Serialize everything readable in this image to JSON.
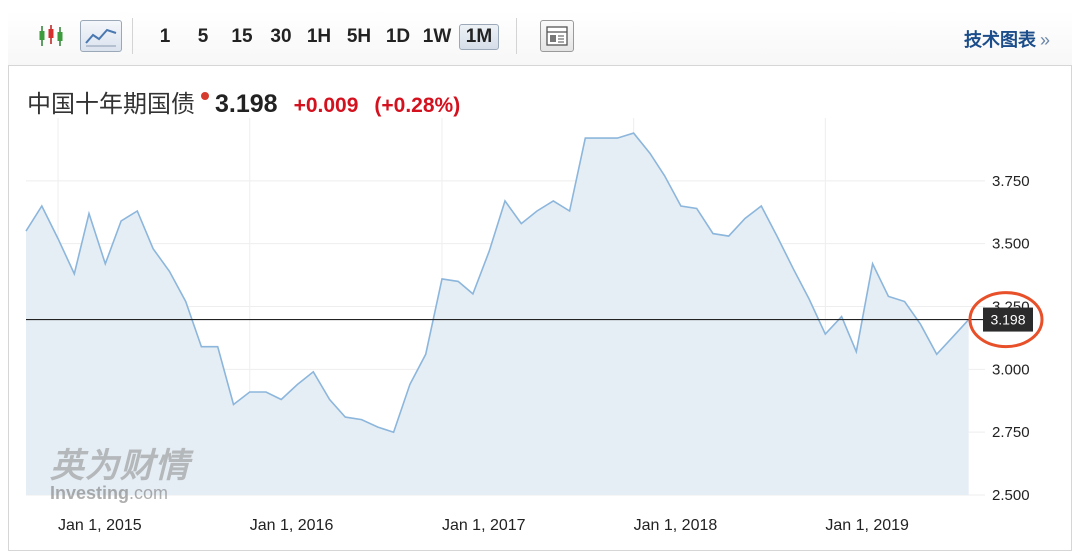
{
  "toolbar": {
    "intervals": [
      "1",
      "5",
      "15",
      "30",
      "1H",
      "5H",
      "1D",
      "1W",
      "1M"
    ],
    "active_interval": "1M",
    "tech_chart_label": "技术图表",
    "tech_chart_chevron": "»"
  },
  "quote": {
    "name": "中国十年期国债",
    "price": "3.198",
    "change": "+0.009",
    "change_pct": "(+0.28%)",
    "change_color": "#d4111e"
  },
  "watermark": {
    "cn": "英为财情",
    "en": "Investing",
    "en_suffix": ".com"
  },
  "chart_data": {
    "type": "area",
    "x_ticks": [
      "Jan 1, 2015",
      "Jan 1, 2016",
      "Jan 1, 2017",
      "Jan 1, 2018",
      "Jan 1, 2019"
    ],
    "y_ticks": [
      "3.750",
      "3.500",
      "3.250",
      "3.000",
      "2.750",
      "2.500"
    ],
    "ylim": [
      2.5,
      4.0
    ],
    "xlim": [
      "2014-11-01",
      "2019-11-01"
    ],
    "last_value_label": "3.198",
    "last_value": 3.198,
    "line_color": "#8cb6dc",
    "fill_color": "#e6eef5",
    "series": [
      {
        "x": [
          "2014-11-01",
          "2014-12-01",
          "2015-01-01",
          "2015-02-01",
          "2015-03-01",
          "2015-04-01",
          "2015-05-01",
          "2015-06-01",
          "2015-07-01",
          "2015-08-01",
          "2015-09-01",
          "2015-10-01",
          "2015-11-01",
          "2015-12-01",
          "2016-01-01",
          "2016-02-01",
          "2016-03-01",
          "2016-04-01",
          "2016-05-01",
          "2016-06-01",
          "2016-07-01",
          "2016-08-01",
          "2016-09-01",
          "2016-10-01",
          "2016-11-01",
          "2016-12-01",
          "2017-01-01",
          "2017-02-01",
          "2017-03-01",
          "2017-04-01",
          "2017-05-01",
          "2017-06-01",
          "2017-07-01",
          "2017-08-01",
          "2017-09-01",
          "2017-10-01",
          "2017-11-01",
          "2017-12-01",
          "2018-01-01",
          "2018-02-01",
          "2018-03-01",
          "2018-04-01",
          "2018-05-01",
          "2018-06-01",
          "2018-07-01",
          "2018-08-01",
          "2018-09-01",
          "2018-10-01",
          "2018-11-01",
          "2018-12-01",
          "2019-01-01",
          "2019-02-01",
          "2019-03-01",
          "2019-04-01",
          "2019-05-01",
          "2019-06-01",
          "2019-07-01",
          "2019-08-01",
          "2019-09-01",
          "2019-10-01"
        ],
        "values": [
          3.55,
          3.65,
          3.52,
          3.38,
          3.62,
          3.42,
          3.59,
          3.63,
          3.48,
          3.39,
          3.27,
          3.09,
          3.09,
          2.86,
          2.91,
          2.91,
          2.88,
          2.94,
          2.99,
          2.88,
          2.81,
          2.8,
          2.77,
          2.75,
          2.94,
          3.06,
          3.36,
          3.35,
          3.3,
          3.47,
          3.67,
          3.58,
          3.63,
          3.67,
          3.63,
          3.92,
          3.92,
          3.92,
          3.94,
          3.86,
          3.77,
          3.65,
          3.64,
          3.54,
          3.53,
          3.6,
          3.65,
          3.53,
          3.4,
          3.28,
          3.14,
          3.21,
          3.07,
          3.42,
          3.29,
          3.27,
          3.18,
          3.06,
          3.13,
          3.198
        ]
      }
    ]
  }
}
